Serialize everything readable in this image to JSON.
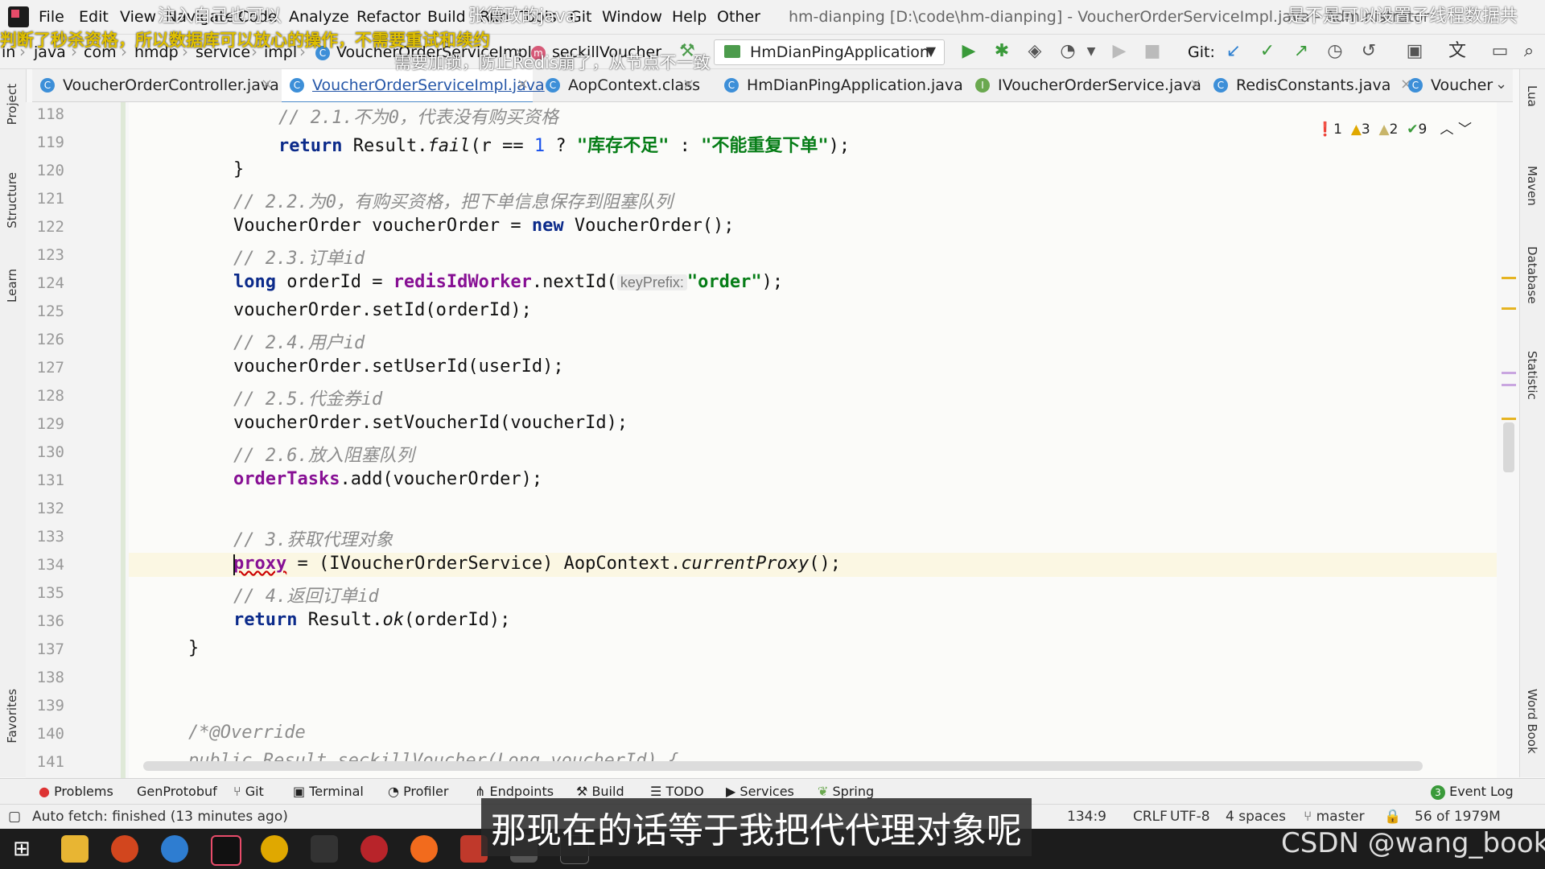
{
  "menu": {
    "items": [
      "File",
      "Edit",
      "View",
      "Navigate",
      "Code",
      "Analyze",
      "Refactor",
      "Build",
      "Run",
      "Tools",
      "Git",
      "Window",
      "Help",
      "Other"
    ],
    "window_title": "hm-dianping [D:\\code\\hm-dianping] - VoucherOrderServiceImpl.java - Administrator"
  },
  "breadcrumb": [
    "in",
    "java",
    "com",
    "hmdp",
    "service",
    "impl",
    "VoucherOrderServiceImpl",
    "seckillVoucher"
  ],
  "run_config": {
    "label": "HmDianPingApplication"
  },
  "toolbar": {
    "git_label": "Git:"
  },
  "tabs": [
    {
      "label": "VoucherOrderController.java",
      "icon": "C"
    },
    {
      "label": "VoucherOrderServiceImpl.java",
      "icon": "C",
      "active": true
    },
    {
      "label": "AopContext.class",
      "icon": "C"
    },
    {
      "label": "HmDianPingApplication.java",
      "icon": "C"
    },
    {
      "label": "IVoucherOrderService.java",
      "icon": "I"
    },
    {
      "label": "RedisConstants.java",
      "icon": "C"
    },
    {
      "label": "Voucher",
      "icon": "C"
    }
  ],
  "inspections": {
    "errors": "1",
    "warnings": "3",
    "weak_warnings": "2",
    "ok": "9"
  },
  "left_tools": [
    "Project",
    "Structure",
    "Learn",
    "Favorites"
  ],
  "right_tools": [
    "Lua",
    "Maven",
    "Database",
    "Statistic",
    "Word Book"
  ],
  "code": {
    "l118": {
      "num": "118",
      "comment": "// 2.1.不为0，代表没有购买资格"
    },
    "l119": {
      "num": "119",
      "kw": "return",
      "a": " Result.",
      "m": "fail",
      "b": "(r == ",
      "n": "1",
      "c": " ? ",
      "s1": "\"库存不足\"",
      "d": " : ",
      "s2": "\"不能重复下单\"",
      "e": ");"
    },
    "l120": {
      "num": "120",
      "text": "}"
    },
    "l121": {
      "num": "121",
      "comment": "// 2.2.为0，有购买资格，把下单信息保存到阻塞队列"
    },
    "l122": {
      "num": "122",
      "a": "VoucherOrder voucherOrder = ",
      "kw": "new",
      "b": " VoucherOrder();"
    },
    "l123": {
      "num": "123",
      "comment": "// 2.3.订单id"
    },
    "l124": {
      "num": "124",
      "kw": "long",
      "a": " orderId = ",
      "f": "redisIdWorker",
      "b": ".nextId(",
      "hint": "keyPrefix:",
      "s": "\"order\"",
      "c": ");"
    },
    "l125": {
      "num": "125",
      "text": "voucherOrder.setId(orderId);"
    },
    "l126": {
      "num": "126",
      "comment": "// 2.4.用户id"
    },
    "l127": {
      "num": "127",
      "text": "voucherOrder.setUserId(userId);"
    },
    "l128": {
      "num": "128",
      "comment": "// 2.5.代金券id"
    },
    "l129": {
      "num": "129",
      "text": "voucherOrder.setVoucherId(voucherId);"
    },
    "l130": {
      "num": "130",
      "comment": "// 2.6.放入阻塞队列"
    },
    "l131": {
      "num": "131",
      "f": "orderTasks",
      "a": ".add(voucherOrder);"
    },
    "l132": {
      "num": "132"
    },
    "l133": {
      "num": "133",
      "comment": "// 3.获取代理对象"
    },
    "l134": {
      "num": "134",
      "f": "proxy",
      "a": " = (IVoucherOrderService) AopContext.",
      "m": "currentProxy",
      "b": "();"
    },
    "l135": {
      "num": "135",
      "comment": "// 4.返回订单id"
    },
    "l136": {
      "num": "136",
      "kw": "return",
      "a": " Result.",
      "m": "ok",
      "b": "(orderId);"
    },
    "l137": {
      "num": "137",
      "text": "}"
    },
    "l138": {
      "num": "138"
    },
    "l139": {
      "num": "139"
    },
    "l140": {
      "num": "140",
      "comment": "/*@Override"
    },
    "l141": {
      "num": "141",
      "comment": "public Result seckillVoucher(Long voucherId) {"
    }
  },
  "bottom_tools": [
    "Problems",
    "GenProtobuf",
    "Git",
    "Terminal",
    "Profiler",
    "Endpoints",
    "Build",
    "TODO",
    "Services",
    "Spring",
    "Event Log"
  ],
  "event_log_count": "3",
  "status": {
    "message": "Auto fetch: finished (13 minutes ago)",
    "position": "134:9",
    "line_sep": "CRLF",
    "encoding": "UTF-8",
    "indent": "4 spaces",
    "branch": "master",
    "memory": "56 of 1979M"
  },
  "overlays": {
    "danmaku1": "注入自己也可以",
    "danmaku2": "张德政的java",
    "danmaku3": "是不是可以设置子线程数据共",
    "danmaku4": "判断了秒杀资格，所以数据库可以放心的操作，不需要重试和续约",
    "danmaku5": "需要加锁，防止Redis崩了，从节点不一致",
    "subtitle": "那现在的话等于我把代代理对象呢",
    "watermark": "CSDN @wang_book"
  },
  "colors": {
    "keyword": "#0b2a8a",
    "string": "#067d17",
    "comment": "#8c8c8c",
    "field": "#871094",
    "accent": "#4a88c7"
  }
}
